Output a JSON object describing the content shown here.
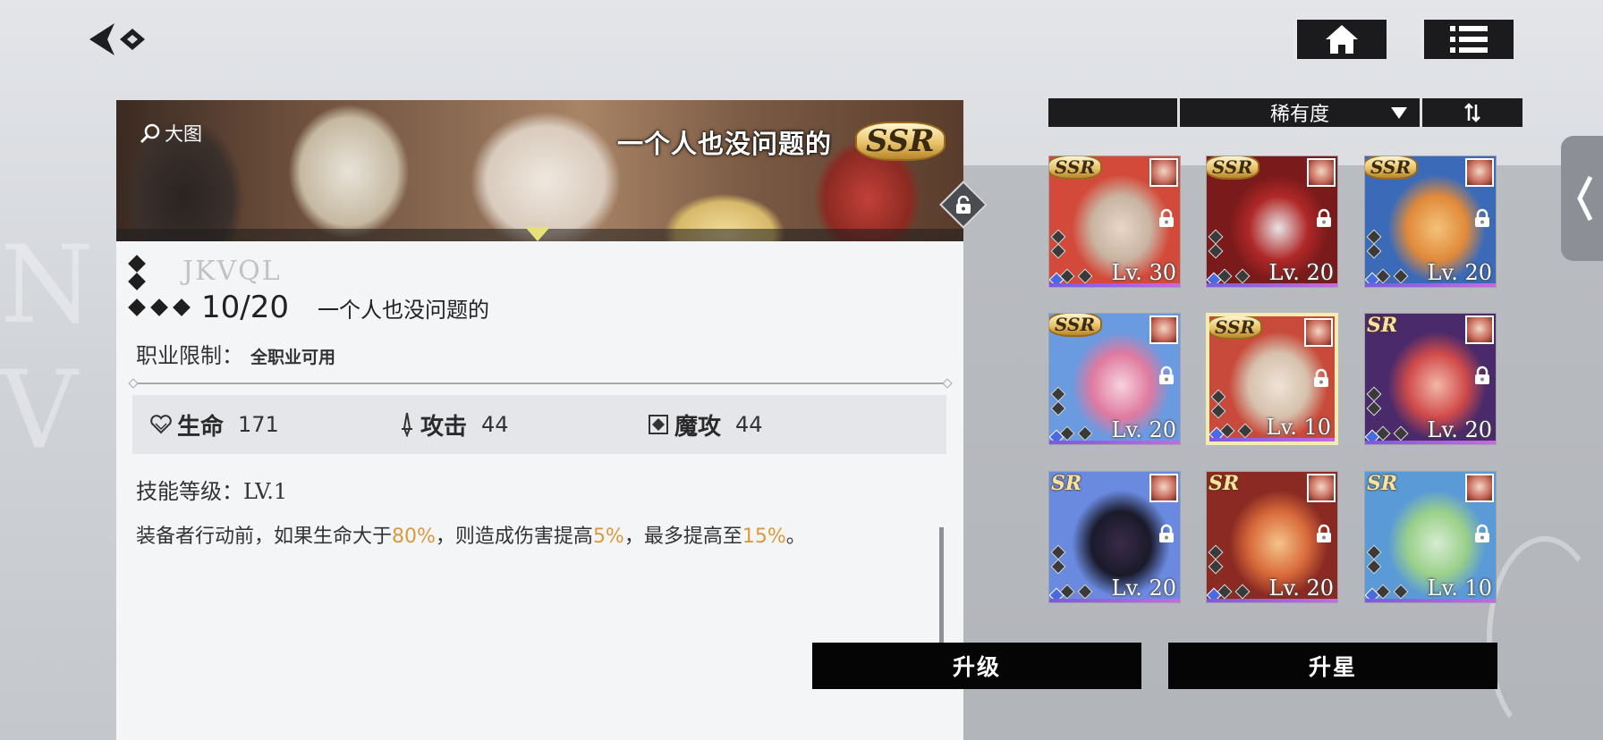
{
  "banner": {
    "zoom_label": "大图",
    "title": "一个人也没问题的",
    "rarity": "SSR"
  },
  "equipment": {
    "name_emblem": "JKVQL",
    "level": "10/20",
    "name": "一个人也没问题的",
    "job_label": "职业限制：",
    "job_value": "全职业可用"
  },
  "stats": [
    {
      "icon": "heart-icon",
      "label": "生命",
      "value": "171"
    },
    {
      "icon": "sword-icon",
      "label": "攻击",
      "value": "44"
    },
    {
      "icon": "magic-icon",
      "label": "魔攻",
      "value": "44"
    }
  ],
  "skill": {
    "level_text": "技能等级：LV.1",
    "desc_1": "装备者行动前，如果生命大于",
    "val_1": "80%",
    "desc_2": "，则造成伤害提高",
    "val_2": "5%",
    "desc_3": "，最多提高至",
    "val_3": "15%",
    "desc_4": "。"
  },
  "sort": {
    "label": "稀有度"
  },
  "cards": [
    {
      "rarity": "SSR",
      "level": "Lv. 30",
      "stars": 4,
      "colors": [
        "#e9d6c8",
        "#c9b4a2",
        "#d44a3a"
      ],
      "selected": false
    },
    {
      "rarity": "SSR",
      "level": "Lv. 20",
      "stars": 4,
      "colors": [
        "#e8e4e6",
        "#b02828",
        "#7a1a1a"
      ],
      "selected": false
    },
    {
      "rarity": "SSR",
      "level": "Lv. 20",
      "stars": 4,
      "colors": [
        "#f3c27a",
        "#e18a3a",
        "#3a6ab8"
      ],
      "selected": false
    },
    {
      "rarity": "SSR",
      "level": "Lv. 20",
      "stars": 4,
      "colors": [
        "#f6d2dc",
        "#e07aa0",
        "#6a9ae0"
      ],
      "selected": false
    },
    {
      "rarity": "SSR",
      "level": "Lv. 10",
      "stars": 4,
      "colors": [
        "#efe3d6",
        "#d6c1ad",
        "#c84a3a"
      ],
      "selected": true
    },
    {
      "rarity": "SR",
      "level": "Lv. 20",
      "stars": 4,
      "colors": [
        "#f2b8a8",
        "#d04a4a",
        "#4a2a6a"
      ],
      "selected": false
    },
    {
      "rarity": "SR",
      "level": "Lv. 20",
      "stars": 4,
      "colors": [
        "#3a2a4a",
        "#1a1a2a",
        "#6a8ae0"
      ],
      "selected": false
    },
    {
      "rarity": "SR",
      "level": "Lv. 20",
      "stars": 4,
      "colors": [
        "#f4c48a",
        "#d86a3a",
        "#8a2a22"
      ],
      "selected": false
    },
    {
      "rarity": "SR",
      "level": "Lv. 10",
      "stars": 4,
      "colors": [
        "#d6ecd0",
        "#9ad08a",
        "#5a9ad6"
      ],
      "selected": false
    }
  ],
  "actions": {
    "upgrade_label": "升级",
    "star_label": "升星"
  },
  "colors": {
    "highlight": "#d99a3c",
    "button_bg": "#050505",
    "panel_bg": "#f4f5f7"
  }
}
